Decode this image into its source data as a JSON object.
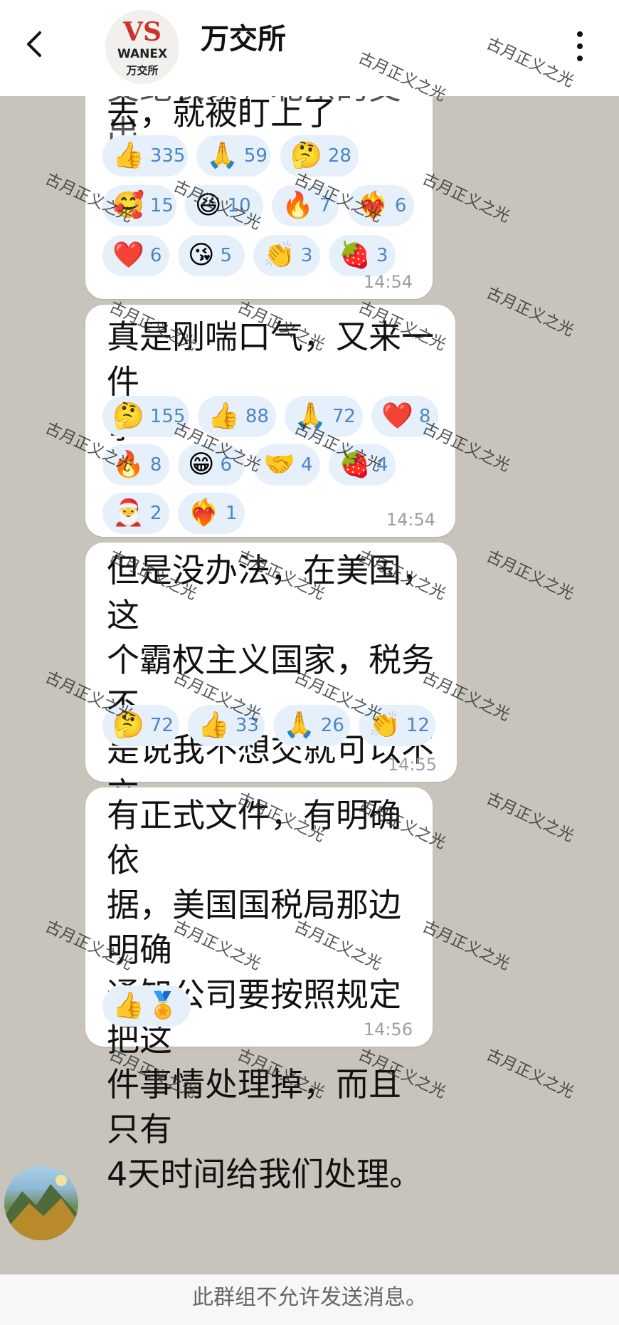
{
  "header": {
    "title": "万交所",
    "logo_mark": "VS",
    "logo_en": "WANEX",
    "logo_cn": "万交所"
  },
  "messages": [
    {
      "text": "去，就被盯上了",
      "partial_text": "交纪长家，北东的交出",
      "reactions": [
        {
          "emoji": "👍",
          "count": "335"
        },
        {
          "emoji": "🙏",
          "count": "59"
        },
        {
          "emoji": "🤔",
          "count": "28"
        },
        {
          "emoji": "🥰",
          "count": "15"
        },
        {
          "emoji": "😆",
          "count": "10"
        },
        {
          "emoji": "🔥",
          "count": "7"
        },
        {
          "emoji": "❤️‍🔥",
          "count": "6"
        },
        {
          "emoji": "❤️",
          "count": "6"
        },
        {
          "emoji": "😘",
          "count": "5"
        },
        {
          "emoji": "👏",
          "count": "3"
        },
        {
          "emoji": "🍓",
          "count": "3"
        }
      ],
      "time": "14:54"
    },
    {
      "text": "真是刚喘口气，又来一件\n事",
      "reactions": [
        {
          "emoji": "🤔",
          "count": "155"
        },
        {
          "emoji": "👍",
          "count": "88"
        },
        {
          "emoji": "🙏",
          "count": "72"
        },
        {
          "emoji": "❤️",
          "count": "8"
        },
        {
          "emoji": "🔥",
          "count": "8"
        },
        {
          "emoji": "😁",
          "count": "6"
        },
        {
          "emoji": "🤝",
          "count": "4"
        },
        {
          "emoji": "🍓",
          "count": "4"
        },
        {
          "emoji": "🎅",
          "count": "2"
        },
        {
          "emoji": "❤️‍🔥",
          "count": "1"
        }
      ],
      "time": "14:54"
    },
    {
      "text": "但是没办法，在美国，这\n个霸权主义国家，税务不\n是说我不想交就可以不交\n的",
      "reactions": [
        {
          "emoji": "🤔",
          "count": "72"
        },
        {
          "emoji": "👍",
          "count": "33"
        },
        {
          "emoji": "🙏",
          "count": "26"
        },
        {
          "emoji": "👏",
          "count": "12"
        }
      ],
      "time": "14:55"
    },
    {
      "text": "有正式文件，有明确依\n据，美国国税局那边明确\n通知公司要按照规定把这\n件事情处理掉，而且只有\n4天时间给我们处理。",
      "reactions": [
        {
          "emoji": "👍",
          "count": ""
        },
        {
          "emoji": "🏅",
          "count": ""
        }
      ],
      "time": "14:56"
    }
  ],
  "footer": {
    "notice": "此群组不允许发送消息。"
  },
  "watermark": "古月正义之光",
  "colors": {
    "chat_bg": "#c9c4bb",
    "reaction_bg": "#e6f0fb",
    "reaction_count": "#4a86c5",
    "time": "#9aa0a6"
  }
}
